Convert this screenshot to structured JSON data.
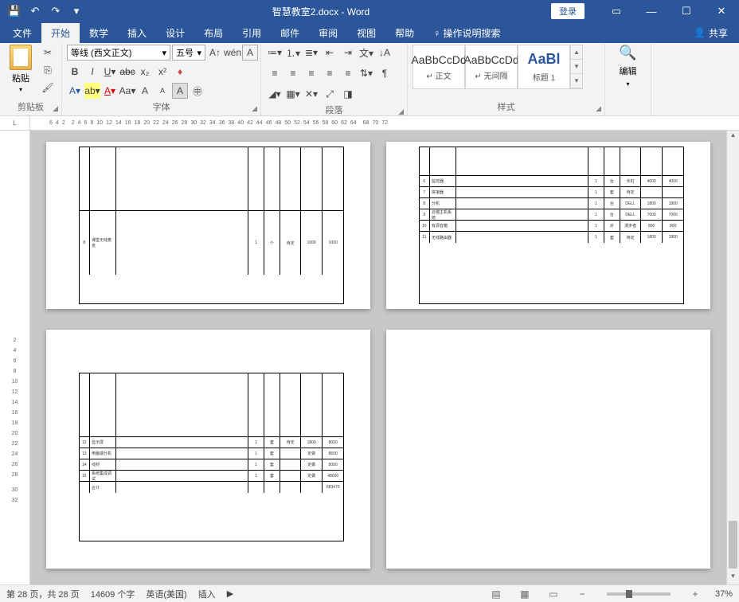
{
  "titlebar": {
    "doc_title": "智慧教室2.docx  -  Word",
    "login": "登录"
  },
  "tabs": {
    "file": "文件",
    "home": "开始",
    "math": "数学",
    "insert": "插入",
    "design": "设计",
    "layout": "布局",
    "references": "引用",
    "mailings": "邮件",
    "review": "审阅",
    "view": "视图",
    "help": "帮助",
    "tell_me": "操作说明搜索",
    "share": "共享"
  },
  "ribbon": {
    "clipboard": {
      "label": "剪贴板",
      "paste": "粘贴"
    },
    "font": {
      "label": "字体",
      "name": "等线 (西文正文)",
      "size": "五号",
      "pinyin": "wén"
    },
    "paragraph": {
      "label": "段落"
    },
    "styles": {
      "label": "样式",
      "s1_preview": "AaBbCcDd",
      "s1_name": "↵ 正文",
      "s2_preview": "AaBbCcDd",
      "s2_name": "↵ 无间隔",
      "s3_preview": "AaBl",
      "s3_name": "标题 1"
    },
    "editing": {
      "label": "编辑"
    }
  },
  "ruler_left_label": "L",
  "ruler_h": [
    "6",
    "4",
    "2",
    "",
    "2",
    "4",
    "6",
    "8",
    "10",
    "12",
    "14",
    "16",
    "18",
    "20",
    "22",
    "24",
    "26",
    "28",
    "30",
    "32",
    "34",
    "36",
    "38",
    "40",
    "42",
    "44",
    "46",
    "48",
    "50",
    "52",
    "54",
    "56",
    "58",
    "60",
    "62",
    "64",
    "",
    "68",
    "70",
    "72"
  ],
  "ruler_v": [
    "2",
    "4",
    "6",
    "8",
    "10",
    "12",
    "14",
    "16",
    "18",
    "20",
    "22",
    "24",
    "26",
    "28",
    "",
    "30",
    "32"
  ],
  "status": {
    "page": "第 28 页，共 28 页",
    "words": "14609 个字",
    "lang": "英语(美国)",
    "mode": "插入",
    "zoom": "37%"
  },
  "table_sample": {
    "p3_rows": [
      {
        "idx": "",
        "name": "",
        "n1": "",
        "n2": "",
        "n3": "",
        "n4": "",
        "n5": ""
      },
      {
        "idx": "8",
        "name": "课堂无线麦克",
        "n1": "1",
        "n2": "个",
        "n3": "待定",
        "n4": "1000",
        "n5": "1000"
      }
    ],
    "p2_rows": [
      {
        "idx": "6",
        "name": "监控器",
        "n1": "1",
        "n2": "台",
        "n3": "长虹",
        "n4": "4000",
        "n5": "4000"
      },
      {
        "idx": "7",
        "name": "拼接器",
        "n1": "1",
        "n2": "套",
        "n3": "待定",
        "n4": "",
        "n5": ""
      },
      {
        "idx": "8",
        "name": "分机",
        "n1": "1",
        "n2": "台",
        "n3": "DELL",
        "n4": "1800",
        "n5": "1800"
      },
      {
        "idx": "9",
        "name": "云端主机系统",
        "n1": "1",
        "n2": "台",
        "n3": "DELL",
        "n4": "7000",
        "n5": "7000"
      },
      {
        "idx": "10",
        "name": "有源音箱",
        "n1": "1",
        "n2": "对",
        "n3": "漫步者",
        "n4": "800",
        "n5": "800"
      },
      {
        "idx": "11",
        "name": "无线路由器",
        "n1": "1",
        "n2": "套",
        "n3": "待定",
        "n4": "1800",
        "n5": "1800"
      }
    ],
    "p3b_rows": [
      {
        "idx": "12",
        "name": "显示屏",
        "n1": "1",
        "n2": "套",
        "n3": "待定",
        "n4": "1800",
        "n5": "8000"
      },
      {
        "idx": "13",
        "name": "电脑端分机",
        "n1": "1",
        "n2": "套",
        "n3": "",
        "n4": "定做",
        "n5": "8500"
      },
      {
        "idx": "14",
        "name": "线材",
        "n1": "1",
        "n2": "套",
        "n3": "",
        "n4": "定做",
        "n5": "8000"
      },
      {
        "idx": "15",
        "name": "系统集成调试",
        "n1": "1",
        "n2": "套",
        "n3": "",
        "n4": "定做",
        "n5": "48000"
      },
      {
        "idx": "",
        "name": "合计",
        "n1": "",
        "n2": "",
        "n3": "",
        "n4": "",
        "n5": "683470"
      }
    ]
  }
}
